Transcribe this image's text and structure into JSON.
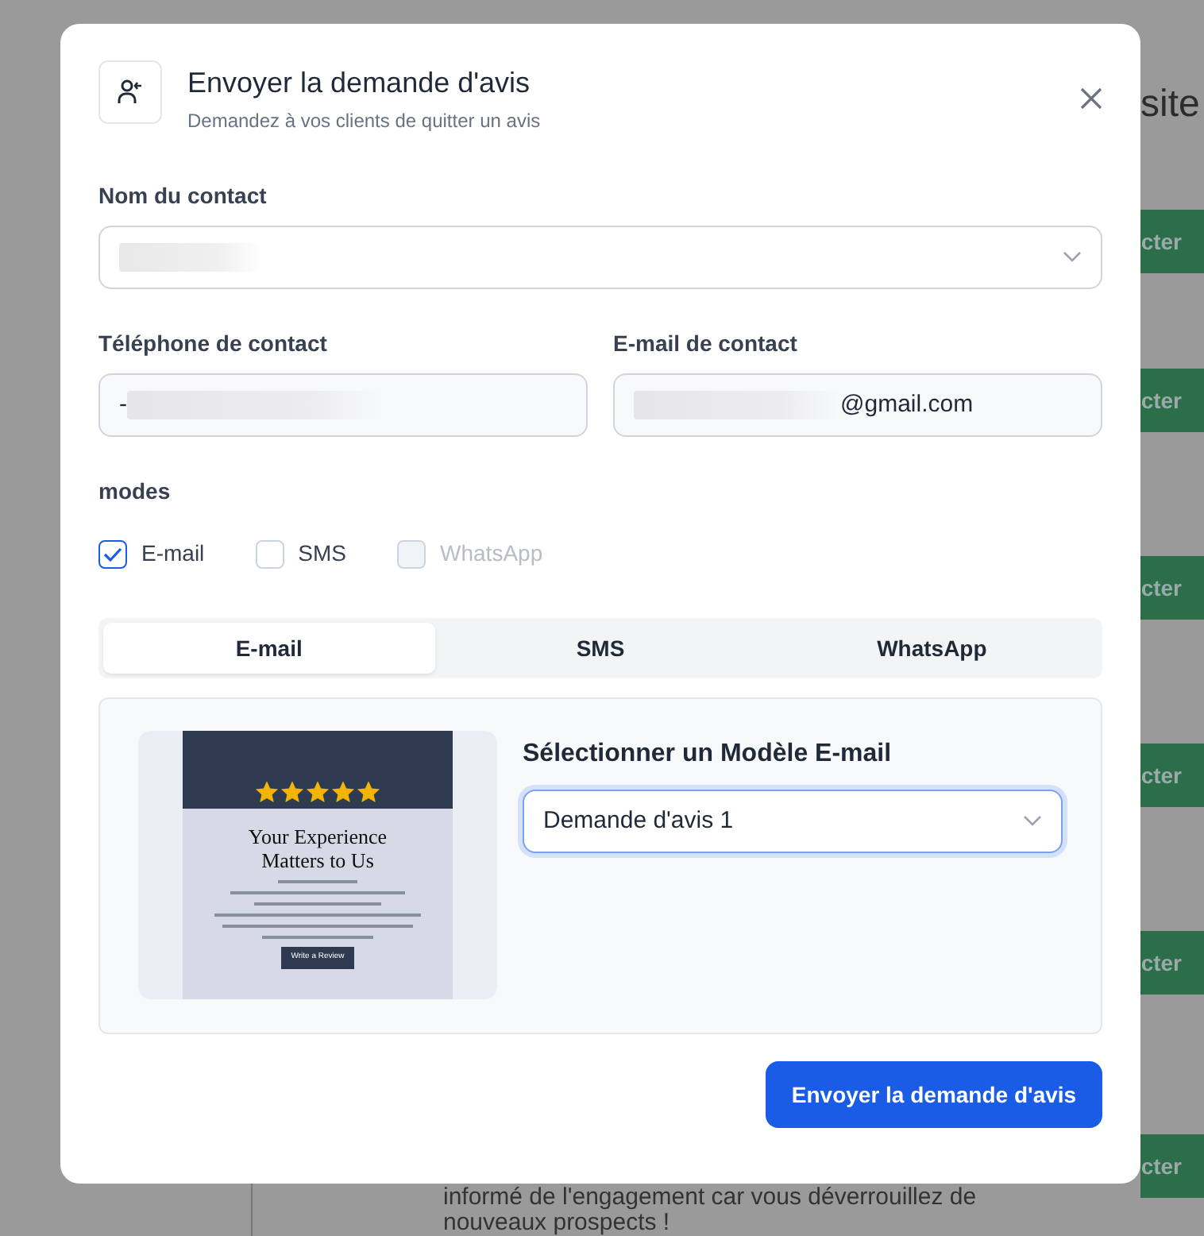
{
  "background": {
    "heading": "site",
    "buttons": [
      "cter",
      "cter",
      "cter",
      "cter",
      "cter",
      "cter"
    ],
    "paragraph": [
      "informé de l'engagement car vous déverrouillez de",
      "nouveaux prospects !"
    ]
  },
  "dialog": {
    "title": "Envoyer la demande d'avis",
    "subtitle": "Demandez à vos clients de quitter un avis"
  },
  "contact_name": {
    "label": "Nom du contact",
    "redacted": true
  },
  "phone": {
    "label": "Téléphone de contact",
    "value": "-",
    "redacted": true
  },
  "email": {
    "label": "E-mail de contact",
    "value": "@gmail.com",
    "redacted": true
  },
  "modes": {
    "label": "modes",
    "options": [
      {
        "label": "E-mail",
        "checked": true,
        "disabled": false
      },
      {
        "label": "SMS",
        "checked": false,
        "disabled": false
      },
      {
        "label": "WhatsApp",
        "checked": false,
        "disabled": true
      }
    ]
  },
  "tabs": [
    {
      "label": "E-mail",
      "selected": true
    },
    {
      "label": "SMS",
      "selected": false
    },
    {
      "label": "WhatsApp",
      "selected": false
    }
  ],
  "template": {
    "preview": {
      "title": "Your Experience Matters to Us",
      "button": "Write a Review",
      "stars": 5
    },
    "label": "Sélectionner un Modèle E-mail",
    "value": "Demande d'avis 1"
  },
  "submit": "Envoyer la demande d'avis"
}
